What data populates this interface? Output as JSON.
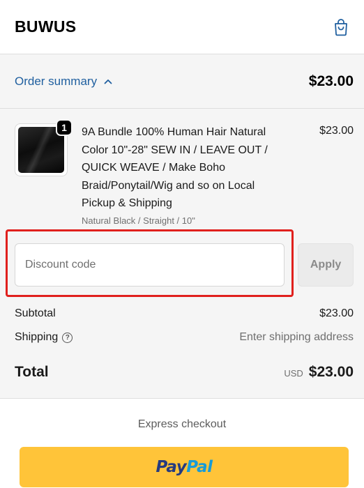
{
  "header": {
    "brand": "BUWUS",
    "cart_icon": "shopping-bag-icon"
  },
  "summary": {
    "toggle_label": "Order summary",
    "toggle_icon": "chevron-up-icon",
    "total": "$23.00",
    "link_color": "#1f5f9f"
  },
  "line_item": {
    "quantity": "1",
    "title": "9A Bundle 100% Human Hair Natural Color 10\"-28\" SEW IN / LEAVE OUT / QUICK WEAVE / Make Boho Braid/Ponytail/Wig and so on Local Pickup & Shipping",
    "variant": "Natural Black / Straight / 10\"",
    "price": "$23.00"
  },
  "discount": {
    "placeholder": "Discount code",
    "value": "",
    "apply_label": "Apply",
    "highlight_color": "#e0201d"
  },
  "totals": {
    "subtotal_label": "Subtotal",
    "subtotal_value": "$23.00",
    "shipping_label": "Shipping",
    "shipping_help_icon": "question-circle-icon",
    "shipping_value": "Enter shipping address",
    "total_label": "Total",
    "currency": "USD",
    "total_value": "$23.00"
  },
  "express": {
    "label": "Express checkout",
    "paypal_pay": "Pay",
    "paypal_pal": "Pal",
    "paypal_color": "#ffc439"
  }
}
